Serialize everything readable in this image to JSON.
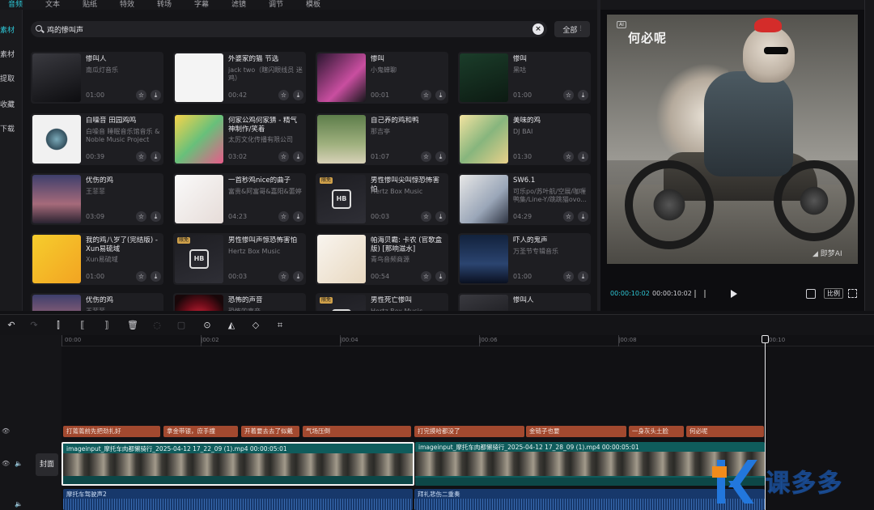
{
  "tabs": [
    "音频",
    "文本",
    "贴纸",
    "特效",
    "转场",
    "字幕",
    "滤镜",
    "调节",
    "模板"
  ],
  "active_tab": 0,
  "side_nav": [
    "素材",
    "素材",
    "提取",
    "收藏",
    "下载"
  ],
  "search": {
    "value": "鸡的惨叫声",
    "filter_label": "全部"
  },
  "cards": [
    {
      "title": "惨叫人",
      "artist": "南瓜灯音乐",
      "duration": "01:00",
      "thumb": "t-dark"
    },
    {
      "title": "外婆家的猫 节选",
      "artist": "jack two（瞎闪眼线员 迷鸡）",
      "duration": "00:42",
      "thumb": "t-white"
    },
    {
      "title": "惨叫",
      "artist": "小鬼蝉聊",
      "duration": "00:01",
      "thumb": "t-pink"
    },
    {
      "title": "惨叫",
      "artist": "黑咕",
      "duration": "01:00",
      "thumb": "t-green"
    },
    {
      "title": "白噪音 田园鸡鸣",
      "artist": "白噪音 睡眠音乐馆音乐 & Noble Music Project",
      "duration": "00:39",
      "thumb": "t-wave"
    },
    {
      "title": "何家公鸡何家猜 - 精气神制作/笑着",
      "artist": "太厉文化传播有限公司",
      "duration": "03:02",
      "thumb": "t-cartoon"
    },
    {
      "title": "自己养的鸡和鸭",
      "artist": "那吉亭",
      "duration": "01:07",
      "thumb": "t-nature"
    },
    {
      "title": "美味的鸡",
      "artist": "DJ BAI",
      "duration": "01:30",
      "thumb": "t-egg"
    },
    {
      "title": "优伤的鸡",
      "artist": "王菲菲",
      "duration": "03:09",
      "thumb": "t-dusk"
    },
    {
      "title": "一首秒鸡nice的曲子",
      "artist": "富贵&阿富哥&嘉阳&蕾婷",
      "duration": "04:23",
      "thumb": "t-anime"
    },
    {
      "title": "男性惨叫尖叫惊恐怖害怕",
      "artist": "Hertz Box Music",
      "duration": "00:03",
      "thumb": "t-hb",
      "badge": "限免"
    },
    {
      "title": "SW6.1",
      "artist": "可乐po/苏叶航/空展/咖喱鸭集/Line-Y/跳跳猫ovo...",
      "duration": "04:29",
      "thumb": "t-sw"
    },
    {
      "title": "我的鸡八岁了(完结版) - Xun易硫域",
      "artist": "Xun易硫域",
      "duration": "01:00",
      "thumb": "t-yellow"
    },
    {
      "title": "男性惨叫声惊恐怖害怕",
      "artist": "Hertz Box Music",
      "duration": "00:03",
      "thumb": "t-hb",
      "badge": "限免"
    },
    {
      "title": "帕海贝霸: 卡农 (官歌盒版) [那响滋水]",
      "artist": "青鸟音频商源",
      "duration": "00:54",
      "thumb": "t-kids"
    },
    {
      "title": "吓人的鬼声",
      "artist": "万圣节专辑音乐",
      "duration": "01:00",
      "thumb": "t-night"
    },
    {
      "title": "优伤的鸡",
      "artist": "王菲菲",
      "duration": "",
      "thumb": "t-dusk"
    },
    {
      "title": "恐怖的声音",
      "artist": "恐怖的声音",
      "duration": "",
      "thumb": "t-red"
    },
    {
      "title": "男性死亡惨叫",
      "artist": "Hertz Box Music",
      "duration": "",
      "thumb": "t-hb",
      "badge": "限免"
    },
    {
      "title": "惨叫人",
      "artist": "",
      "duration": "",
      "thumb": "t-dark"
    }
  ],
  "preview": {
    "caption": "何必呢",
    "watermark": "◢ 即梦AI",
    "tag": "AI",
    "current_time": "00:00:10:02",
    "total_time": "00:00:10:02",
    "ratio_label": "比例"
  },
  "ruler_labels": [
    "00:00",
    "|00:02",
    "|00:04",
    "|00:06",
    "|00:08",
    "00:10"
  ],
  "cover_label": "封面",
  "text_clips": [
    "打蔫蔫前先把劲扎好",
    "拿金带银，庶手撞",
    "开着要去去了似戴",
    "气场压倒",
    "打完摸哈都没了",
    "金链子也要",
    "一身灰头土脸",
    "何必呢"
  ],
  "video_clips": [
    {
      "label": "imageinput_摩托车肉都懒骑行_2025-04-12 17_22_09 (1).mp4   00:00:05:01"
    },
    {
      "label": "imageinput_摩托车肉都懒骑行_2025-04-12 17_28_09 (1).mp4   00:00:05:01"
    }
  ],
  "audio_clips": [
    "摩托车驾驶声2",
    "拜礼悲伤二重奏"
  ],
  "brand": {
    "text": "课多多"
  }
}
